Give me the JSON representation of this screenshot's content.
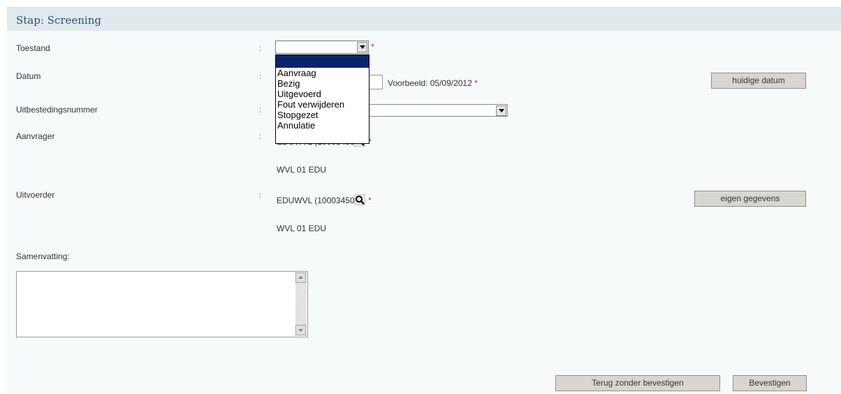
{
  "header": {
    "title": "Stap: Screening"
  },
  "labels": {
    "toestand": "Toestand",
    "datum": "Datum",
    "uitbestedingsnummer": "Uitbestedingsnummer",
    "aanvrager": "Aanvrager",
    "uitvoerder": "Uitvoerder",
    "samenvatting": "Samenvatting:",
    "colon": ":"
  },
  "toestand": {
    "selected_value": "",
    "options": [
      "",
      "Aanvraag",
      "Bezig",
      "Uitgevoerd",
      "Fout verwijderen",
      "Stopgezet",
      "Annulatie"
    ]
  },
  "datum": {
    "value": "",
    "example": "Voorbeeld: 05/09/2012",
    "today_button": "huidige datum"
  },
  "uitbestedingsnummer": {
    "selected_value": ""
  },
  "aanvrager": {
    "code": "EDUWVL (10003450)",
    "name": "WVL 01 EDU"
  },
  "uitvoerder": {
    "code": "EDUWVL (10003450)",
    "name": "WVL 01 EDU",
    "own_data_button": "eigen gegevens"
  },
  "samenvatting": {
    "value": ""
  },
  "required_marker": "*",
  "footer": {
    "back_button": "Terug zonder bevestigen",
    "confirm_button": "Bevestigen"
  },
  "colors": {
    "header_bg": "#dfe9ee",
    "header_text": "#2a5473",
    "required": "#d02020",
    "dropdown_selected": "#0a246a",
    "button_bg": "#d9d6cf"
  },
  "icons": [
    "chevron-down-icon",
    "search-icon",
    "scroll-up-icon",
    "scroll-down-icon"
  ]
}
